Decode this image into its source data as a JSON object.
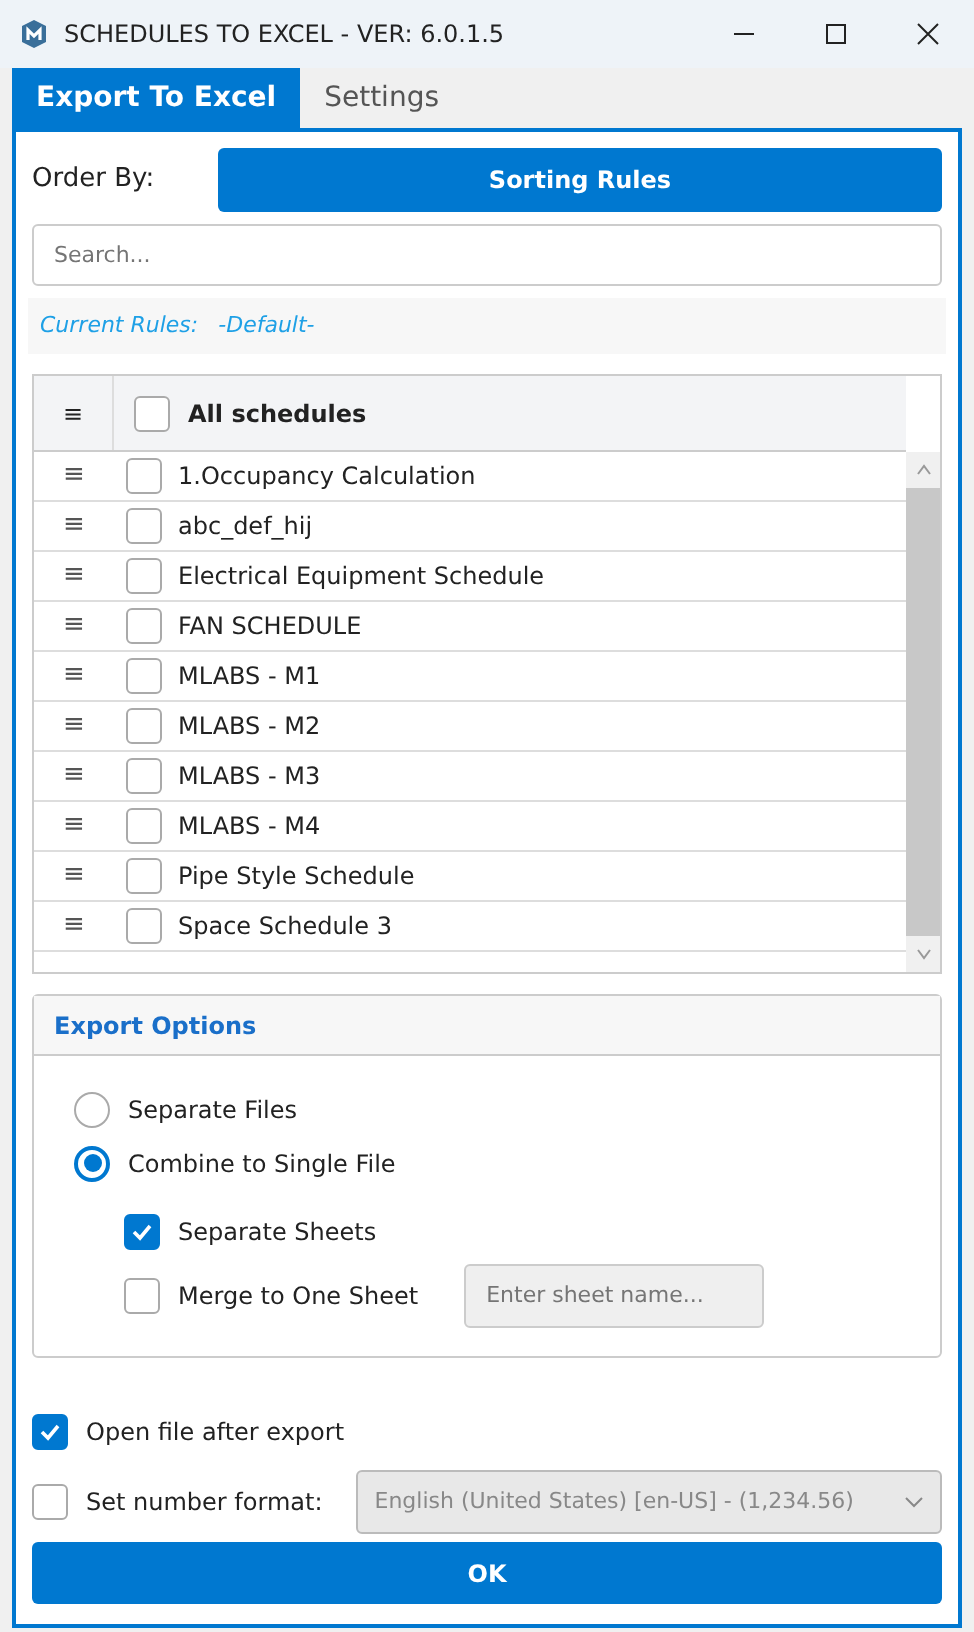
{
  "window": {
    "title": "SCHEDULES TO EXCEL - VER: 6.0.1.5"
  },
  "tabs": [
    {
      "label": "Export To Excel",
      "selected": true
    },
    {
      "label": "Settings",
      "selected": false
    }
  ],
  "order_by": {
    "label": "Order By:",
    "button": "Sorting Rules"
  },
  "search": {
    "placeholder": "Search..."
  },
  "current_rules": {
    "label": "Current Rules:",
    "value": "-Default-"
  },
  "table": {
    "header": {
      "handle": "≡",
      "label": "All schedules",
      "checked": false
    },
    "rows": [
      {
        "handle": "≡",
        "name": "1.Occupancy Calculation",
        "checked": false
      },
      {
        "handle": "≡",
        "name": "abc_def_hij",
        "checked": false
      },
      {
        "handle": "≡",
        "name": "Electrical Equipment Schedule",
        "checked": false
      },
      {
        "handle": "≡",
        "name": "FAN SCHEDULE",
        "checked": false
      },
      {
        "handle": "≡",
        "name": "MLABS - M1",
        "checked": false
      },
      {
        "handle": "≡",
        "name": "MLABS - M2",
        "checked": false
      },
      {
        "handle": "≡",
        "name": "MLABS - M3",
        "checked": false
      },
      {
        "handle": "≡",
        "name": "MLABS - M4",
        "checked": false
      },
      {
        "handle": "≡",
        "name": "Pipe Style Schedule",
        "checked": false
      },
      {
        "handle": "≡",
        "name": "Space Schedule 3",
        "checked": false
      }
    ]
  },
  "export_options": {
    "title": "Export Options",
    "modes": [
      {
        "label": "Separate Files",
        "selected": false
      },
      {
        "label": "Combine to Single File",
        "selected": true
      }
    ],
    "sheets": [
      {
        "label": "Separate Sheets",
        "checked": true
      },
      {
        "label": "Merge to One Sheet",
        "checked": false,
        "field": {
          "placeholder": "Enter sheet name...",
          "disabled": true
        }
      }
    ]
  },
  "open_after_export": {
    "label": "Open file after export",
    "checked": true
  },
  "number_format": {
    "label": "Set number format:",
    "checked": false,
    "value": "English (United States) [en-US] - (1,234.56)",
    "disabled": true
  },
  "ok_button": "OK"
}
